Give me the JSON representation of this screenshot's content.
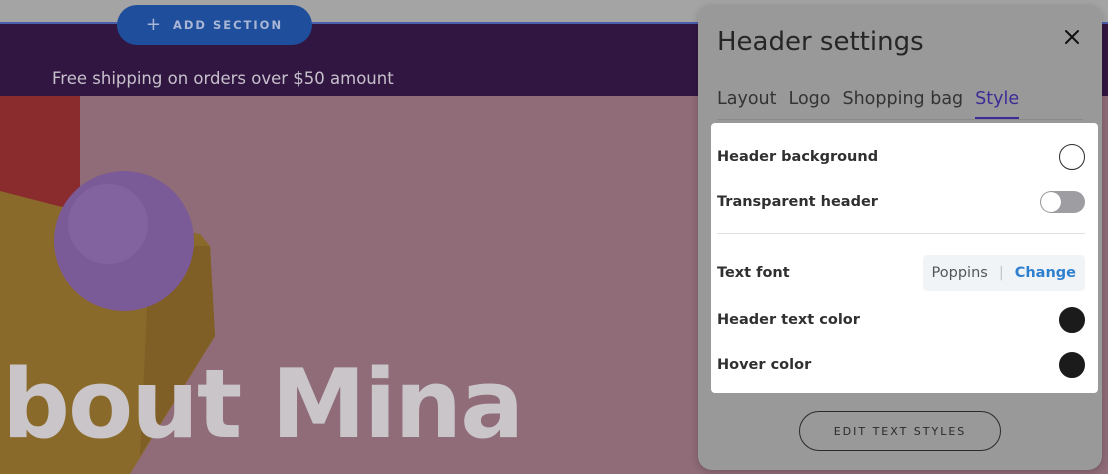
{
  "site": {
    "announcement": "Free shipping on orders over $50 amount",
    "hero_heading": "bout Mina",
    "add_section_label": "ADD SECTION"
  },
  "panel": {
    "title": "Header settings",
    "tabs": [
      {
        "label": "Layout",
        "active": false
      },
      {
        "label": "Logo",
        "active": false
      },
      {
        "label": "Shopping bag",
        "active": false
      },
      {
        "label": "Style",
        "active": true
      }
    ],
    "settings": {
      "header_background": {
        "label": "Header background",
        "color": "#ffffff"
      },
      "transparent_header": {
        "label": "Transparent header",
        "enabled": false
      },
      "text_font": {
        "label": "Text font",
        "value": "Poppins",
        "action": "Change"
      },
      "header_text_color": {
        "label": "Header text color",
        "color": "#1b1b1b"
      },
      "hover_color": {
        "label": "Hover color",
        "color": "#1b1b1b"
      }
    },
    "edit_text_styles_label": "EDIT TEXT STYLES"
  },
  "colors": {
    "announcement_bar": "#311641",
    "add_section_button": "#1f4f9c",
    "active_tab": "#3b2b97",
    "link": "#2f7fcf"
  },
  "icons": {
    "close": "close-icon",
    "plus": "plus-icon"
  }
}
